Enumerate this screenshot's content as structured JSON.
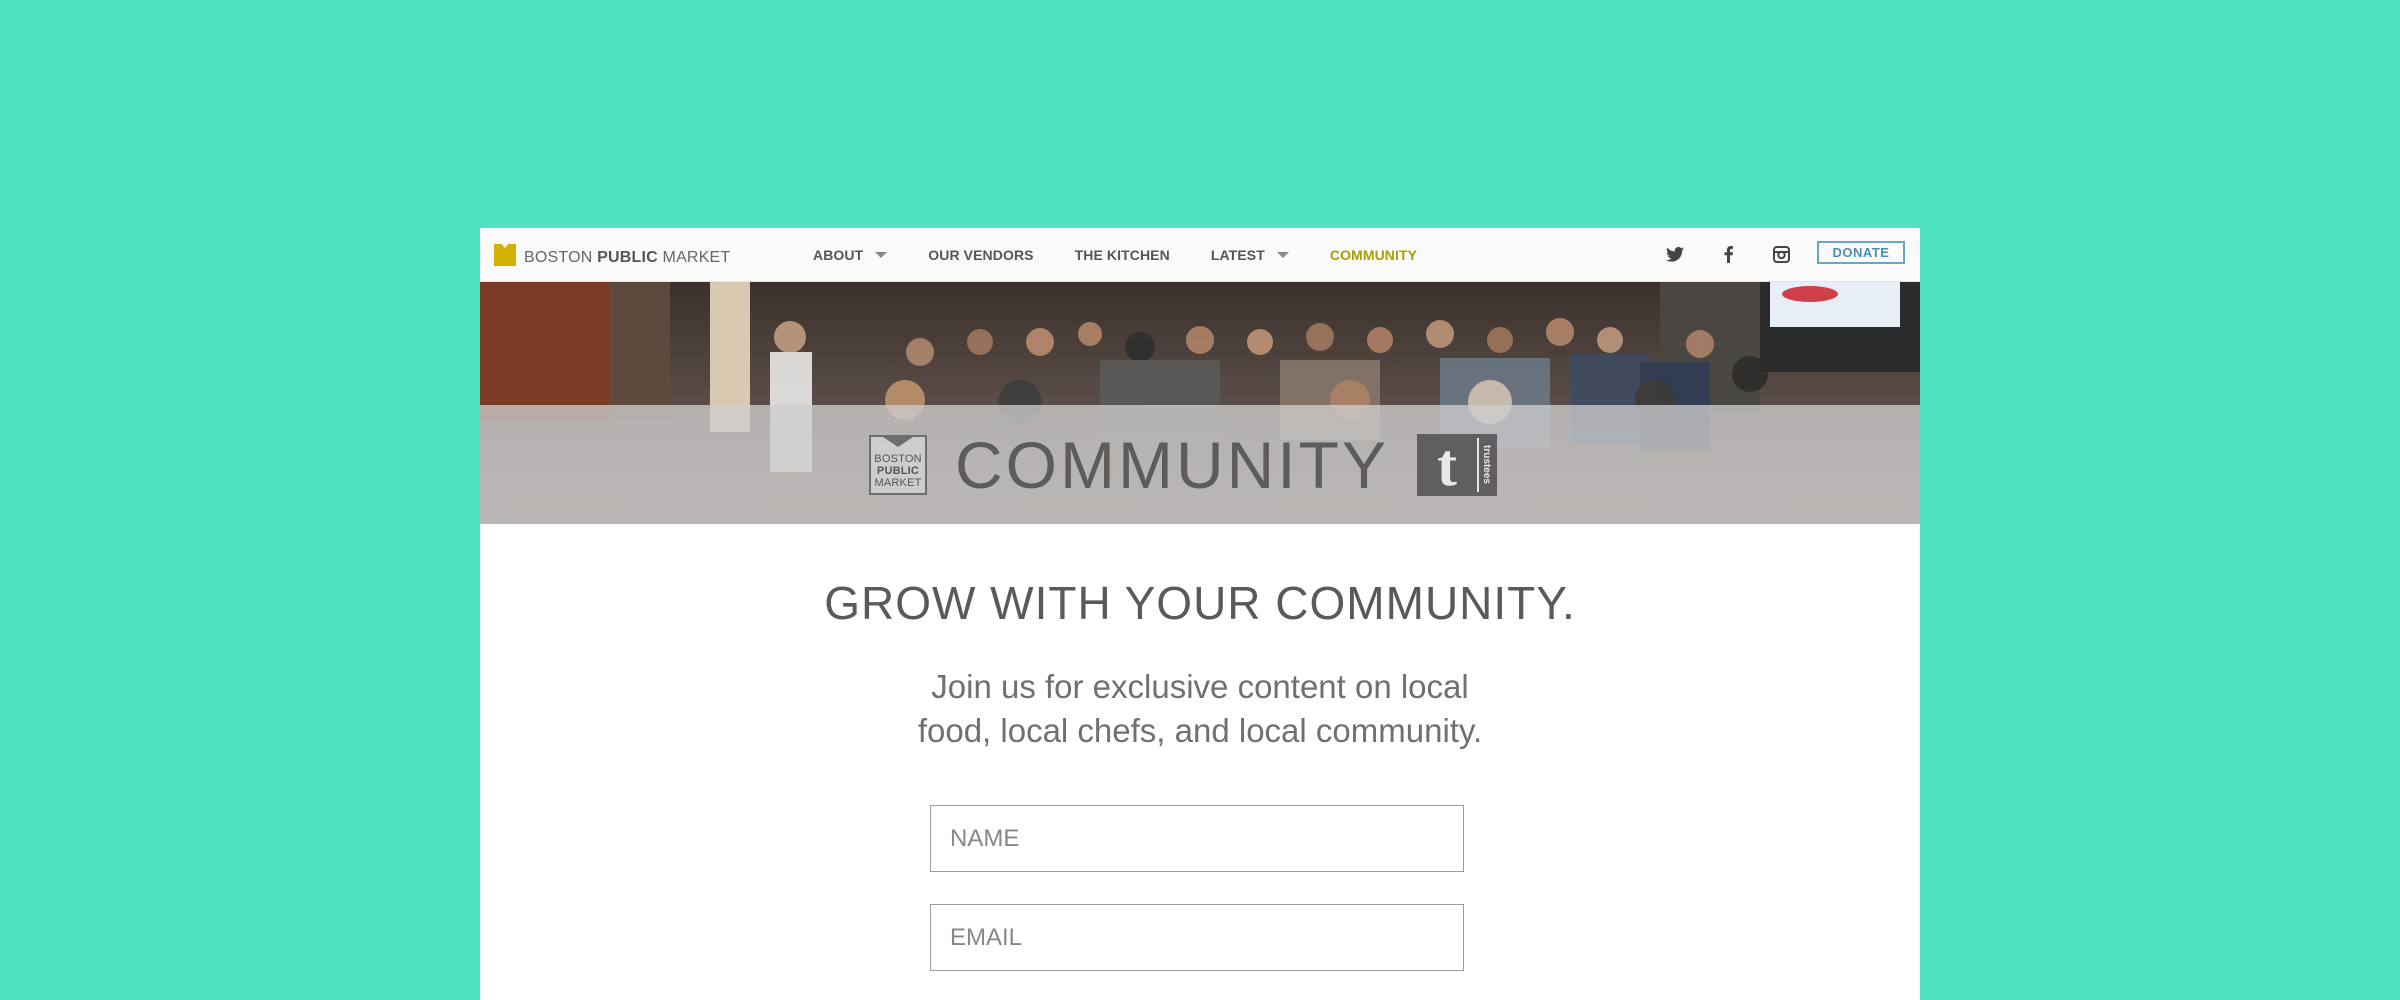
{
  "nav": {
    "logo_part1": "BOSTON ",
    "logo_part2": "PUBLIC",
    "logo_part3": " MARKET",
    "items": [
      {
        "label": "ABOUT",
        "has_dropdown": true
      },
      {
        "label": "OUR VENDORS",
        "has_dropdown": false
      },
      {
        "label": "THE KITCHEN",
        "has_dropdown": false
      },
      {
        "label": "LATEST",
        "has_dropdown": true
      },
      {
        "label": "COMMUNITY",
        "has_dropdown": false,
        "active": true
      }
    ],
    "social_icons": [
      "twitter-icon",
      "facebook-icon",
      "instagram-icon"
    ],
    "donate_label": "DONATE"
  },
  "hero": {
    "badge_line1": "BOSTON",
    "badge_line2": "PUBLIC",
    "badge_line3": "MARKET",
    "title": "COMMUNITY",
    "tumblr_letter": "t",
    "tumblr_word": "trustees"
  },
  "main": {
    "headline": "GROW WITH YOUR COMMUNITY.",
    "subtext": "Join us for exclusive content on local food, local chefs, and local community.",
    "name_placeholder": "NAME",
    "email_placeholder": "EMAIL"
  },
  "colors": {
    "page_bg": "#50e3c2",
    "accent_active": "#a8a000",
    "logo_mark": "#d4b106",
    "donate_border": "#6aa7c2"
  }
}
